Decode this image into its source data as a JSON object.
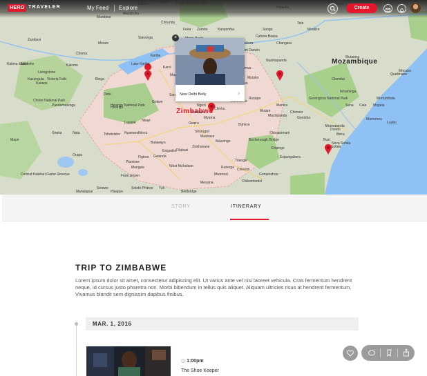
{
  "header": {
    "logo_badge": "HERO",
    "logo_text": "TRAVELER",
    "nav": [
      "My Feed",
      "Explore"
    ],
    "create_label": "Create",
    "icons": [
      "search-icon",
      "message-icon",
      "notification-bell-icon",
      "avatar"
    ]
  },
  "map": {
    "country_labels": {
      "zimbabwe": "Zimbabwe",
      "mozambique": "Mozambique"
    },
    "places": [
      "Lusaka",
      "Kafue National Park",
      "Mazabuka",
      "Chirundu",
      "Chinhoyi",
      "Kariba",
      "Victoria Falls",
      "Hwange",
      "Bulawayo",
      "Gweru",
      "Chitungwiza",
      "Mutare",
      "Masvingo",
      "Chimoio",
      "Tete",
      "Quelimane",
      "Beira",
      "Hwange National Park",
      "Gonarezhou",
      "Francistown",
      "Zvishavane",
      "Chobe National Park",
      "Central Kalahari Game Reserve",
      "Sofala",
      "Nova Sofala",
      "Gorongosa National Park",
      "Chiredzi",
      "Plumtree",
      "Gwanda",
      "Beitbridge",
      "Mutoko",
      "Murehwa",
      "Kadoma",
      "Kwekwe",
      "Shurugwi",
      "Rusape",
      "Marondera",
      "Chegutu",
      "Chipinge",
      "Nhamatanda",
      "Sena",
      "Caia",
      "Mopeia",
      "Morrumbala",
      "Mocuba",
      "Luabo",
      "Marromeu",
      "Buzi",
      "Dondo",
      "Inhaminga",
      "Chemba",
      "Mutarara",
      "Nyamapanda",
      "Mukumbura",
      "Mazowe",
      "Bindura",
      "Shamva",
      "Karoi",
      "Magunje",
      "Mhangura",
      "Mount Darwin",
      "Centenary",
      "Guruve",
      "Kanyemba",
      "Mana Pools",
      "Lake Kariba",
      "Binga",
      "Lupane",
      "Nkayi",
      "Tsholotsho",
      "Dete",
      "Kazungula",
      "Kasane",
      "Pandamatenga",
      "Nata",
      "Gweta",
      "Maun",
      "Orapa",
      "Serowe",
      "Palapye",
      "Mahalapye",
      "Selebi-Phikwe",
      "Tuli",
      "Messina",
      "Chipata",
      "Petauke",
      "Kabwe",
      "Mumbwa",
      "Monze",
      "Choma",
      "Kalomo",
      "Livingstone",
      "Sesheke",
      "Katima Mulilo",
      "Zambezi",
      "Siavonga",
      "Feira",
      "Zumbo",
      "Songo",
      "Cahora Bassa",
      "Moatize",
      "Changara",
      "Manica",
      "Gondola",
      "Machipanda",
      "Espungabera",
      "Chimanimani",
      "Birchenough Bridge",
      "Buhera",
      "Chivhu",
      "Mvuma",
      "Gokwe",
      "Sanyati",
      "Mashava",
      "Ngezi",
      "Triangle",
      "Rutenga",
      "Chikombedzi",
      "Mwenezi",
      "West Nicholson",
      "Filabusi",
      "Esigodini",
      "Nyamandhlovu",
      "Figtree",
      "Mangwe"
    ],
    "popup": {
      "title": "New Delhi Belly",
      "image": "woman-carrying-basket-photo"
    }
  },
  "tabs": [
    {
      "label": "STORY",
      "active": false
    },
    {
      "label": "ITINERARY",
      "active": true
    }
  ],
  "trip": {
    "title": "TRIP TO ZIMBABWE",
    "description": "Lorem ipsum dolor sit amet, consectetur adipiscing elit. Ut varius ante vel nisi laoreet vehicula. Cras fermentum hendrerit neque, id cursus justo pharetra non. Morbi bibendum in tellus quis aliquet. Aliquam ultricies risus at hendrerit fermentum. Vivamus blandit sem dignissim dapibus finibus."
  },
  "itinerary": {
    "date": "MAR. 1, 2016",
    "event": {
      "time": "1:00pm",
      "name": "The Shoe Keeper",
      "image": "girl-portrait-photo"
    }
  },
  "actions": {
    "icons": [
      "heart-icon",
      "comment-icon",
      "bookmark-icon",
      "share-icon"
    ]
  },
  "colors": {
    "accent": "#e4182c",
    "map_land": "#d7dcc8",
    "map_water": "#8fc1f4",
    "map_park": "#a9cf8c",
    "zimbabwe_tint": "#f2d6d3"
  }
}
